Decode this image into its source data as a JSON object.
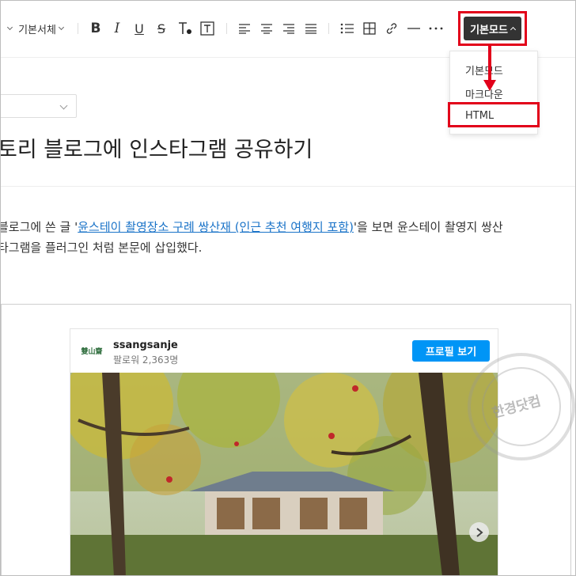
{
  "toolbar": {
    "font_family": "기본서체",
    "mode_label": "기본모드",
    "icons": [
      "bold-icon",
      "italic-icon",
      "underline-icon",
      "strikethrough-icon",
      "text-color-icon",
      "text-background-icon",
      "align-left-icon",
      "align-center-icon",
      "align-right-icon",
      "align-justify-icon",
      "bulleted-list-icon",
      "table-icon",
      "link-icon",
      "horizontal-rule-icon",
      "more-icon"
    ]
  },
  "mode_menu": {
    "items": [
      "기본모드",
      "마크다운",
      "HTML"
    ]
  },
  "post": {
    "title": "토리 블로그에 인스타그램 공유하기",
    "para1_prefix": "블로그에 쓴 글 '",
    "para1_link": "윤스테이 촬영장소 구례 쌍산재 (인근 추천 여행지 포함)",
    "para1_suffix": "'을 보면 윤스테이 촬영지 쌍산",
    "para2": "타그램을 플러그인 처럼 본문에 삽입했다."
  },
  "instagram": {
    "avatar_text": "雙山齋",
    "username": "ssangsanje",
    "followers": "팔로워 2,363명",
    "profile_button": "프로필 보기"
  },
  "watermark": {
    "text": "한경닷컴"
  },
  "colors": {
    "accent_red": "#e2001a",
    "link_blue": "#1a73c8",
    "instagram_blue": "#0095f6"
  }
}
